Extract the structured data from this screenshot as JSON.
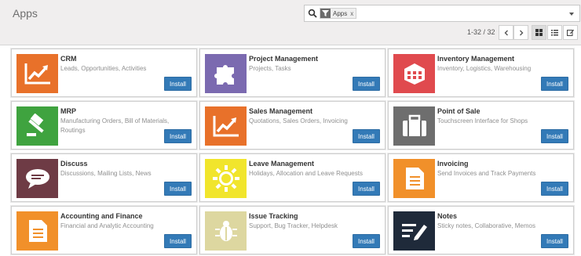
{
  "header": {
    "title": "Apps"
  },
  "search": {
    "facet_label": "Apps",
    "facet_remove": "x"
  },
  "pager": {
    "value": "1-32 / 32"
  },
  "colors": {
    "primary": "#337ab7"
  },
  "apps": [
    {
      "name": "CRM",
      "summary": "Leads, Opportunities, Activities",
      "button": "Install",
      "icon": "chart-line-up-icon",
      "color": "#e8712a"
    },
    {
      "name": "Project Management",
      "summary": "Projects, Tasks",
      "button": "Install",
      "icon": "puzzle-icon",
      "color": "#7b6ab0"
    },
    {
      "name": "Inventory Management",
      "summary": "Inventory, Logistics, Warehousing",
      "button": "Install",
      "icon": "cube-icon",
      "color": "#e04a4e"
    },
    {
      "name": "MRP",
      "summary": "Manufacturing Orders, Bill of Materials, Routings",
      "button": "Install",
      "icon": "gavel-icon",
      "color": "#3fa33f"
    },
    {
      "name": "Sales Management",
      "summary": "Quotations, Sales Orders, Invoicing",
      "button": "Install",
      "icon": "chart-line-up-icon",
      "color": "#e8712a"
    },
    {
      "name": "Point of Sale",
      "summary": "Touchscreen Interface for Shops",
      "button": "Install",
      "icon": "briefcase-icon",
      "color": "#6e6e6e"
    },
    {
      "name": "Discuss",
      "summary": "Discussions, Mailing Lists, News",
      "button": "Install",
      "icon": "speech-bubble-icon",
      "color": "#6e3b45"
    },
    {
      "name": "Leave Management",
      "summary": "Holidays, Allocation and Leave Requests",
      "button": "Install",
      "icon": "sun-icon",
      "color": "#f1e52c"
    },
    {
      "name": "Invoicing",
      "summary": "Send Invoices and Track Payments",
      "button": "Install",
      "icon": "document-icon",
      "color": "#f1902a"
    },
    {
      "name": "Accounting and Finance",
      "summary": "Financial and Analytic Accounting",
      "button": "Install",
      "icon": "document-icon",
      "color": "#f1902a"
    },
    {
      "name": "Issue Tracking",
      "summary": "Support, Bug Tracker, Helpdesk",
      "button": "Install",
      "icon": "bug-icon",
      "color": "#ddd7a0"
    },
    {
      "name": "Notes",
      "summary": "Sticky notes, Collaborative, Memos",
      "button": "Install",
      "icon": "pencil-notes-icon",
      "color": "#1f2a3a"
    }
  ]
}
